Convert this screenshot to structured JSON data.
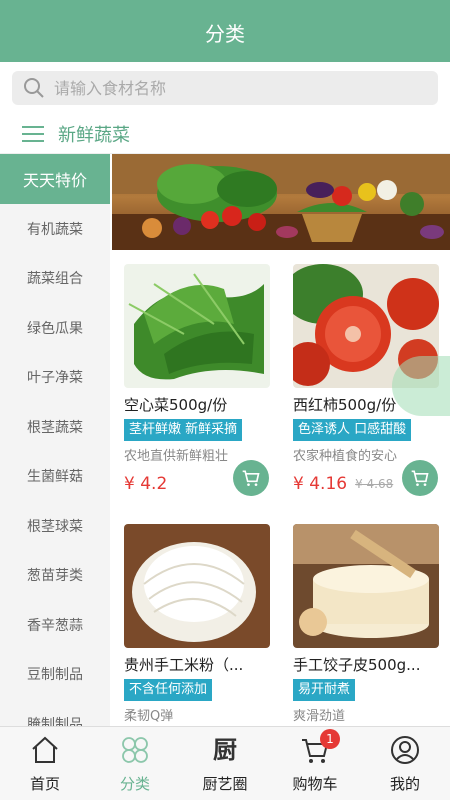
{
  "header": {
    "title": "分类"
  },
  "search": {
    "placeholder": "请输入食材名称"
  },
  "breadcrumb": {
    "label": "新鲜蔬菜"
  },
  "sidebar": {
    "items": [
      {
        "label": "天天特价",
        "active": true
      },
      {
        "label": "有机蔬菜"
      },
      {
        "label": "蔬菜组合"
      },
      {
        "label": "绿色瓜果"
      },
      {
        "label": "叶子净菜"
      },
      {
        "label": "根茎蔬菜"
      },
      {
        "label": "生菌鲜菇"
      },
      {
        "label": "根茎球菜"
      },
      {
        "label": "葱苗芽类"
      },
      {
        "label": "香辛葱蒜"
      },
      {
        "label": "豆制制品"
      },
      {
        "label": "腌制制品"
      }
    ]
  },
  "products": [
    {
      "name": "空心菜500g/份",
      "tag": "茎杆鲜嫩 新鲜采摘",
      "desc": "农地直供新鲜粗壮",
      "price": "¥ 4.2",
      "old_price": ""
    },
    {
      "name": "西红柿500g/份",
      "tag": "色泽诱人 口感甜酸",
      "desc": "农家种植食的安心",
      "price": "¥ 4.16",
      "old_price": "¥ 4.68"
    },
    {
      "name": "贵州手工米粉（...",
      "tag": "不含任何添加",
      "desc": "柔韧Q弹",
      "price": "",
      "old_price": ""
    },
    {
      "name": "手工饺子皮500g...",
      "tag": "易开耐煮",
      "desc": "爽滑劲道",
      "price": "",
      "old_price": ""
    }
  ],
  "tabbar": {
    "items": [
      {
        "label": "首页",
        "icon": "home-icon"
      },
      {
        "label": "分类",
        "icon": "category-icon",
        "active": true
      },
      {
        "label": "厨艺圈",
        "icon": "kitchen-icon",
        "glyph": "厨"
      },
      {
        "label": "购物车",
        "icon": "cart-icon",
        "badge": "1"
      },
      {
        "label": "我的",
        "icon": "user-icon"
      }
    ]
  },
  "colors": {
    "brand": "#68b391",
    "tag": "#2aa7c5",
    "price": "#e53935"
  }
}
